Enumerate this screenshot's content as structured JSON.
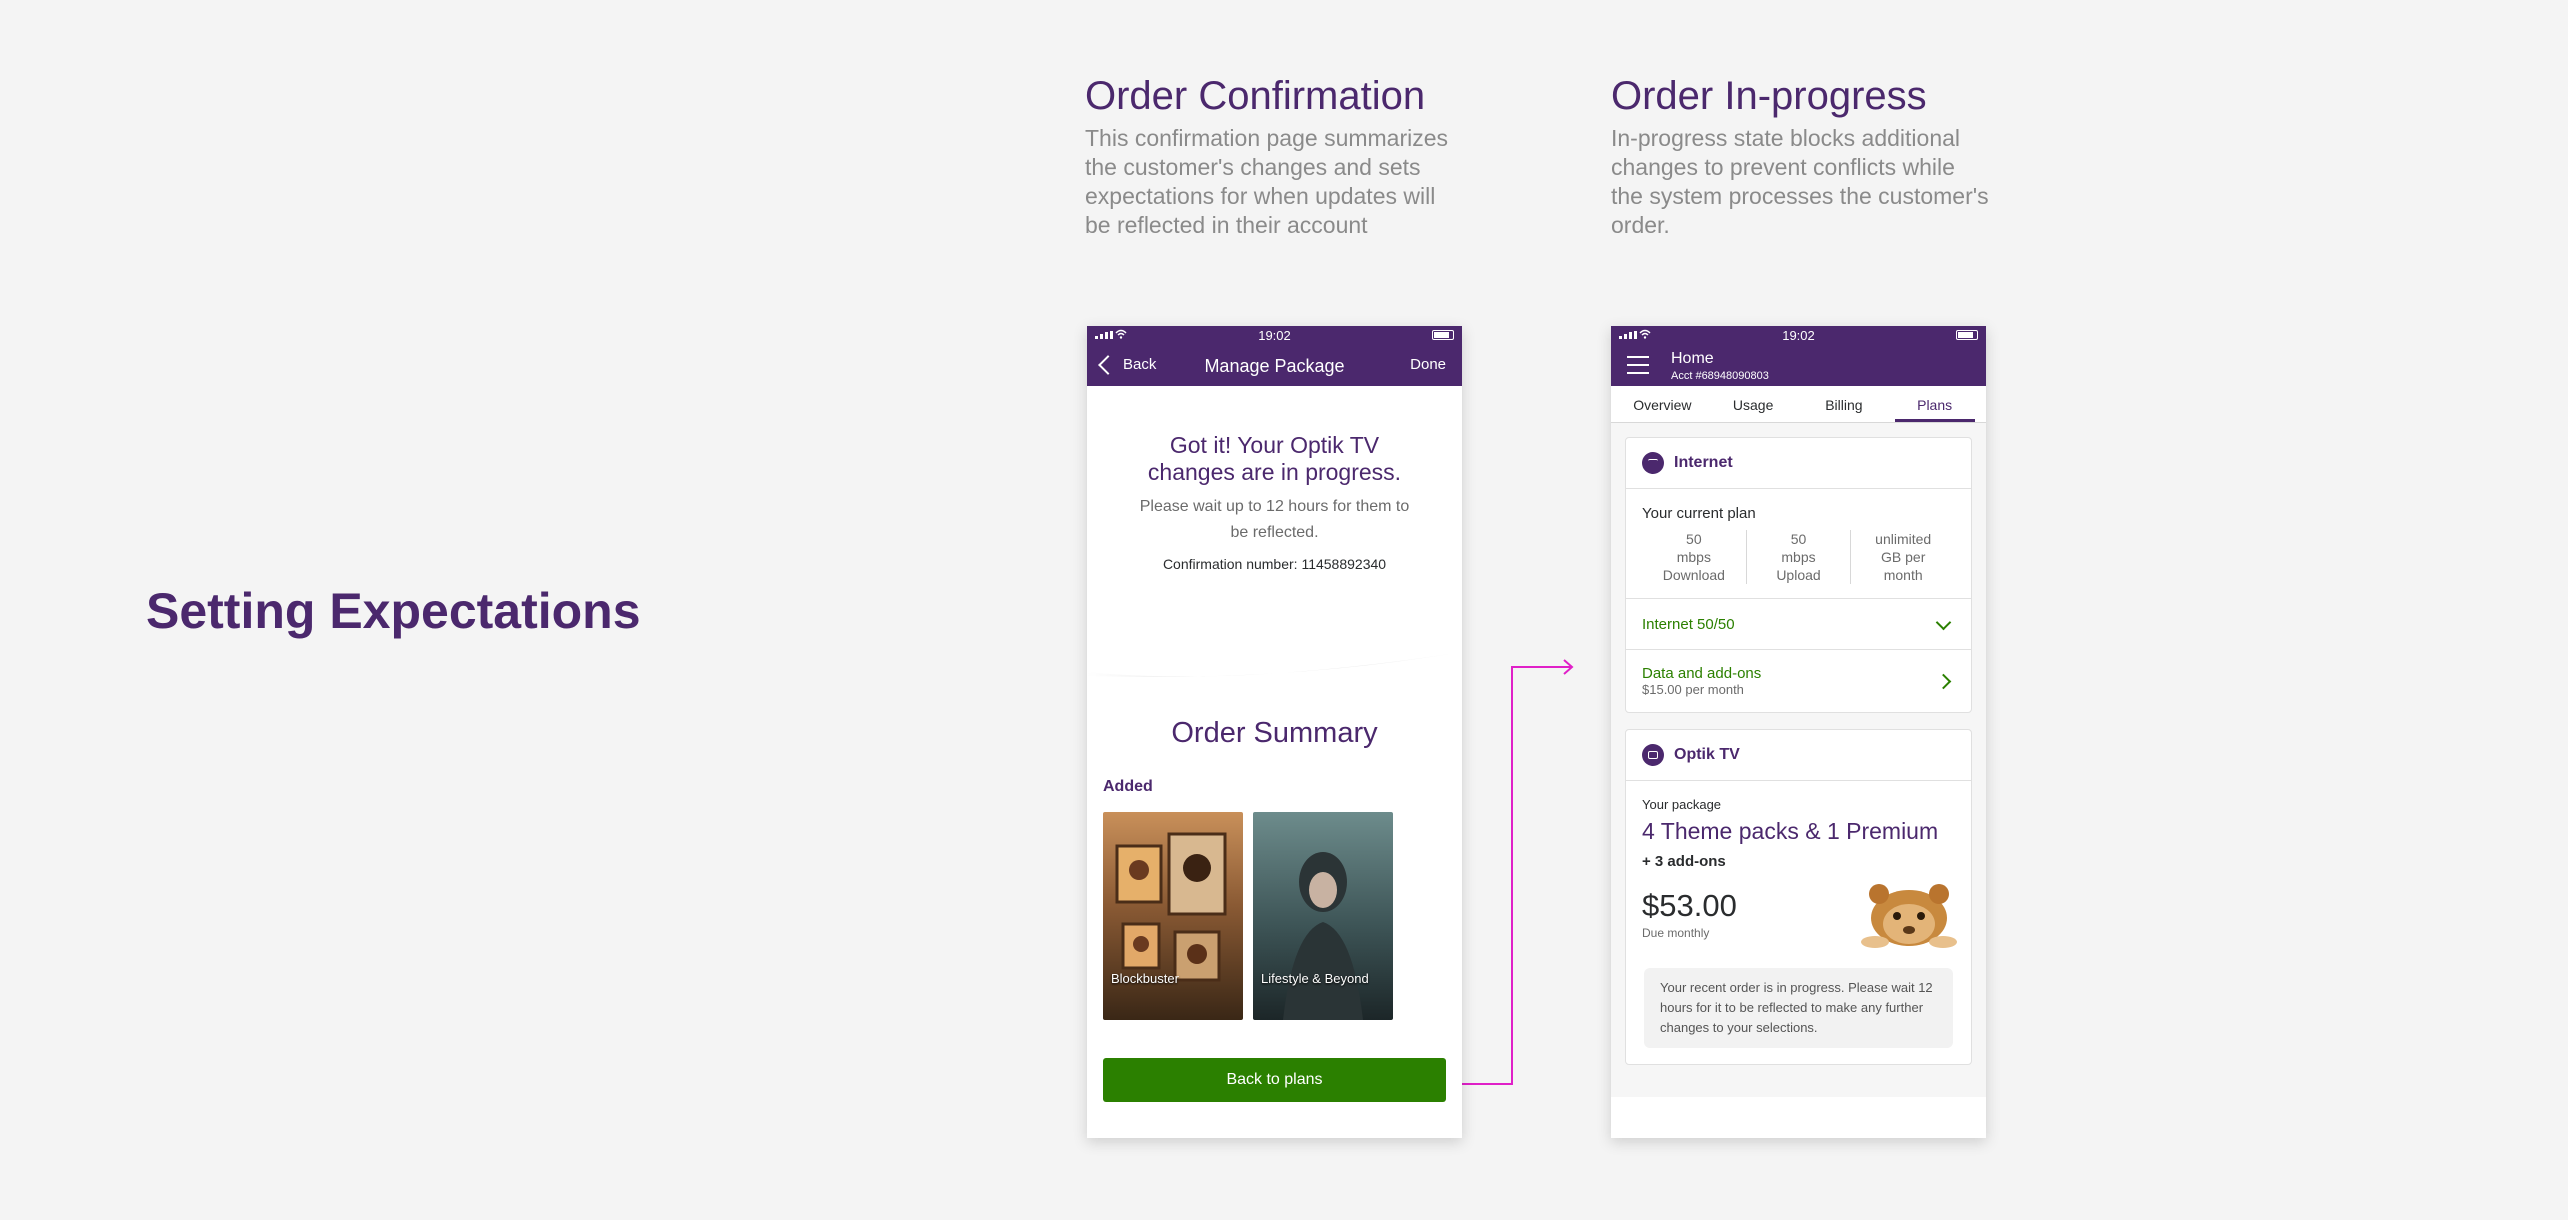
{
  "hero": {
    "title": "Setting Expectations"
  },
  "sections": [
    {
      "title": "Order Confirmation",
      "description": "This confirmation page summarizes the customer's changes and sets expectations for when updates will be reflected in their account"
    },
    {
      "title": "Order In-progress",
      "description": "In-progress state blocks additional changes to prevent conflicts while the system processes the customer's order."
    }
  ],
  "phone1": {
    "status_time": "19:02",
    "nav": {
      "back_label": "Back",
      "title": "Manage Package",
      "done_label": "Done"
    },
    "headline": "Got it! Your Optik TV changes are in progress.",
    "wait_text": "Please wait up to 12 hours for them to be reflected.",
    "confirmation": "Confirmation number: 11458892340",
    "summary_title": "Order Summary",
    "added_label": "Added",
    "posters": [
      {
        "label": "Blockbuster"
      },
      {
        "label": "Lifestyle & Beyond"
      }
    ],
    "cta_label": "Back to plans"
  },
  "phone2": {
    "status_time": "19:02",
    "nav": {
      "title": "Home",
      "account": "Acct #68948090803"
    },
    "tabs": [
      "Overview",
      "Usage",
      "Billing",
      "Plans"
    ],
    "active_tab": "Plans",
    "internet": {
      "title": "Internet",
      "current_plan_label": "Your current plan",
      "stats": [
        {
          "value": "50",
          "unit": "mbps",
          "label": "Download"
        },
        {
          "value": "50",
          "unit": "mbps",
          "label": "Upload"
        },
        {
          "value": "unlimited",
          "unit": "GB per",
          "label": "month"
        }
      ],
      "plan_row": "Internet 50/50",
      "addons_row": "Data and add-ons",
      "addons_price": "$15.00 per month"
    },
    "tv": {
      "title": "Optik TV",
      "package_label": "Your package",
      "package_name": "4 Theme packs & 1 Premium",
      "addons": "+ 3 add-ons",
      "price": "$53.00",
      "due": "Due monthly",
      "notice": "Your recent order is in progress. Please wait 12 hours for it to be reflected to make any further changes to your selections."
    }
  },
  "colors": {
    "brand": "#4b286d",
    "accent_green": "#2b8000",
    "connector": "#e020c8"
  }
}
